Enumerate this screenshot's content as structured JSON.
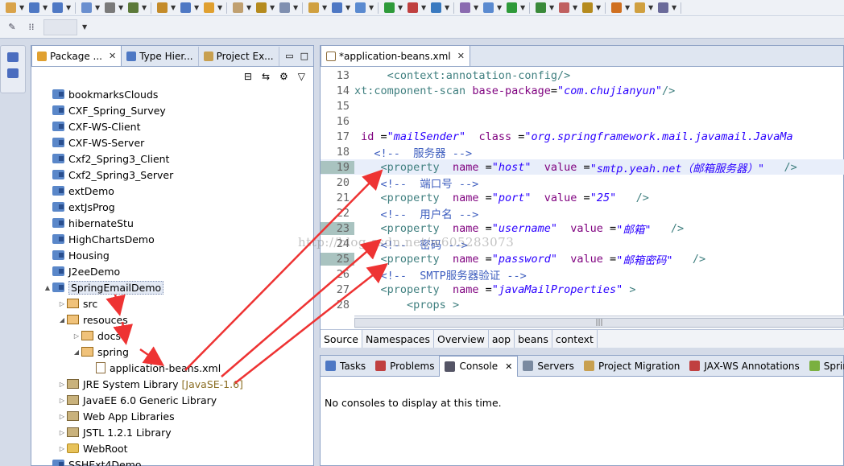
{
  "toolbar": {
    "icons": [
      "new-icon",
      "new-dropdown-icon",
      "save-icon",
      "save-all-icon",
      "print-icon",
      "debug-icon",
      "skip-breakpoints-icon",
      "wrench-icon",
      "back-icon",
      "forward-icon",
      "open-type-icon",
      "open-resource-icon",
      "new-wizard-icon",
      "build-icon",
      "search-icon",
      "run-icon",
      "external-tools-icon",
      "globe-icon",
      "profile-icon",
      "server-icon",
      "run-green-icon",
      "debug-green-icon",
      "coverage-icon",
      "package-icon",
      "refresh-icon",
      "open-folder-icon",
      "pin-icon"
    ]
  },
  "package_explorer": {
    "tabs": [
      {
        "label": "Package ...",
        "icon": "package-explorer-icon",
        "active": true
      },
      {
        "label": "Type Hier...",
        "icon": "type-hierarchy-icon",
        "active": false
      },
      {
        "label": "Project Ex...",
        "icon": "project-explorer-icon",
        "active": false
      }
    ],
    "tree": [
      {
        "label": "bookmarksClouds",
        "kind": "project",
        "depth": 0,
        "twisty": ""
      },
      {
        "label": "CXF_Spring_Survey",
        "kind": "project",
        "depth": 0,
        "twisty": ""
      },
      {
        "label": "CXF-WS-Client",
        "kind": "project",
        "depth": 0,
        "twisty": ""
      },
      {
        "label": "CXF-WS-Server",
        "kind": "project",
        "depth": 0,
        "twisty": ""
      },
      {
        "label": "Cxf2_Spring3_Client",
        "kind": "project",
        "depth": 0,
        "twisty": ""
      },
      {
        "label": "Cxf2_Spring3_Server",
        "kind": "project",
        "depth": 0,
        "twisty": ""
      },
      {
        "label": "extDemo",
        "kind": "project",
        "depth": 0,
        "twisty": ""
      },
      {
        "label": "extJsProg",
        "kind": "project",
        "depth": 0,
        "twisty": ""
      },
      {
        "label": "hibernateStu",
        "kind": "project",
        "depth": 0,
        "twisty": ""
      },
      {
        "label": "HighChartsDemo",
        "kind": "project",
        "depth": 0,
        "twisty": ""
      },
      {
        "label": "Housing",
        "kind": "project",
        "depth": 0,
        "twisty": ""
      },
      {
        "label": "J2eeDemo",
        "kind": "project",
        "depth": 0,
        "twisty": ""
      },
      {
        "label": "SpringEmailDemo",
        "kind": "project",
        "depth": 0,
        "twisty": "▲",
        "selected": true
      },
      {
        "label": "src",
        "kind": "pkg",
        "depth": 1,
        "twisty": "▷"
      },
      {
        "label": "resouces",
        "kind": "pkg",
        "depth": 1,
        "twisty": "◢"
      },
      {
        "label": "docs",
        "kind": "pkg",
        "depth": 2,
        "twisty": "▷"
      },
      {
        "label": "spring",
        "kind": "pkg",
        "depth": 2,
        "twisty": "◢"
      },
      {
        "label": "application-beans.xml",
        "kind": "xml",
        "depth": 3,
        "twisty": ""
      },
      {
        "label": "JRE System Library",
        "kind": "lib",
        "depth": 1,
        "twisty": "▷",
        "tag": "[JavaSE-1.6]"
      },
      {
        "label": "JavaEE 6.0 Generic Library",
        "kind": "lib",
        "depth": 1,
        "twisty": "▷"
      },
      {
        "label": "Web App Libraries",
        "kind": "lib",
        "depth": 1,
        "twisty": "▷"
      },
      {
        "label": "JSTL 1.2.1 Library",
        "kind": "lib",
        "depth": 1,
        "twisty": "▷"
      },
      {
        "label": "WebRoot",
        "kind": "folder",
        "depth": 1,
        "twisty": "▷"
      },
      {
        "label": "SSHExt4Demo",
        "kind": "project",
        "depth": 0,
        "twisty": ""
      }
    ]
  },
  "editor": {
    "tab_label": "*application-beans.xml",
    "lines": [
      {
        "n": "13",
        "parts": [
          [
            "",
            "     "
          ],
          [
            "kw",
            "<context:annotation-config/>"
          ]
        ]
      },
      {
        "n": "14",
        "parts": [
          [
            "kw",
            "xt:component-scan "
          ],
          [
            "attr",
            "base-package"
          ],
          [
            "",
            "="
          ],
          [
            "val",
            "\"com.chujianyun\""
          ],
          [
            "kw",
            "/>"
          ]
        ]
      },
      {
        "n": "15",
        "parts": []
      },
      {
        "n": "16",
        "parts": []
      },
      {
        "n": "17",
        "parts": [
          [
            "attr",
            " id "
          ],
          [
            "",
            "="
          ],
          [
            "val",
            "\"mailSender\""
          ],
          [
            "",
            "  "
          ],
          [
            "attr",
            "class "
          ],
          [
            "",
            "="
          ],
          [
            "val",
            "\"org.springframework.mail.javamail.JavaMa"
          ]
        ]
      },
      {
        "n": "18",
        "parts": [
          [
            "",
            "   "
          ],
          [
            "cmt",
            "<!--  服务器 -->"
          ]
        ]
      },
      {
        "n": "19",
        "hl": true,
        "mark": true,
        "parts": [
          [
            "",
            "    "
          ],
          [
            "kw",
            "<property"
          ],
          [
            "",
            "  "
          ],
          [
            "attr",
            "name "
          ],
          [
            "",
            "="
          ],
          [
            "val",
            "\"host\""
          ],
          [
            "",
            "  "
          ],
          [
            "attr",
            "value "
          ],
          [
            "",
            "="
          ],
          [
            "val",
            "\"smtp.yeah.net（邮箱服务器）\""
          ],
          [
            "",
            "   "
          ],
          [
            "kw",
            "/>"
          ]
        ]
      },
      {
        "n": "20",
        "parts": [
          [
            "",
            "    "
          ],
          [
            "cmt",
            "<!--  端口号 -->"
          ]
        ]
      },
      {
        "n": "21",
        "parts": [
          [
            "",
            "    "
          ],
          [
            "kw",
            "<property"
          ],
          [
            "",
            "  "
          ],
          [
            "attr",
            "name "
          ],
          [
            "",
            "="
          ],
          [
            "val",
            "\"port\""
          ],
          [
            "",
            "  "
          ],
          [
            "attr",
            "value "
          ],
          [
            "",
            "="
          ],
          [
            "val",
            "\"25\""
          ],
          [
            "",
            "   "
          ],
          [
            "kw",
            "/>"
          ]
        ]
      },
      {
        "n": "22",
        "parts": [
          [
            "",
            "    "
          ],
          [
            "cmt",
            "<!--  用户名 -->"
          ]
        ]
      },
      {
        "n": "23",
        "mark": true,
        "parts": [
          [
            "",
            "    "
          ],
          [
            "kw",
            "<property"
          ],
          [
            "",
            "  "
          ],
          [
            "attr",
            "name "
          ],
          [
            "",
            "="
          ],
          [
            "val",
            "\"username\""
          ],
          [
            "",
            "  "
          ],
          [
            "attr",
            "value "
          ],
          [
            "",
            "="
          ],
          [
            "val",
            "\"邮箱\""
          ],
          [
            "",
            "   "
          ],
          [
            "kw",
            "/>"
          ]
        ]
      },
      {
        "n": "24",
        "parts": [
          [
            "",
            "    "
          ],
          [
            "cmt",
            "<!--  密码 -->"
          ]
        ]
      },
      {
        "n": "25",
        "mark": true,
        "parts": [
          [
            "",
            "    "
          ],
          [
            "kw",
            "<property"
          ],
          [
            "",
            "  "
          ],
          [
            "attr",
            "name "
          ],
          [
            "",
            "="
          ],
          [
            "val",
            "\"password\""
          ],
          [
            "",
            "  "
          ],
          [
            "attr",
            "value "
          ],
          [
            "",
            "="
          ],
          [
            "val",
            "\"邮箱密码\""
          ],
          [
            "",
            "   "
          ],
          [
            "kw",
            "/>"
          ]
        ]
      },
      {
        "n": "26",
        "parts": [
          [
            "",
            "    "
          ],
          [
            "cmt",
            "<!--  SMTP服务器验证 -->"
          ]
        ]
      },
      {
        "n": "27",
        "parts": [
          [
            "",
            "    "
          ],
          [
            "kw",
            "<property"
          ],
          [
            "",
            "  "
          ],
          [
            "attr",
            "name "
          ],
          [
            "",
            "="
          ],
          [
            "val",
            "\"javaMailProperties\""
          ],
          [
            "",
            " "
          ],
          [
            "kw",
            ">"
          ]
        ]
      },
      {
        "n": "28",
        "parts": [
          [
            "",
            "        "
          ],
          [
            "kw",
            "<props"
          ],
          [
            "",
            " "
          ],
          [
            "kw",
            ">"
          ]
        ]
      }
    ],
    "bottom_tabs": [
      {
        "label": "Source",
        "active": true
      },
      {
        "label": "Namespaces",
        "active": false
      },
      {
        "label": "Overview",
        "active": false
      },
      {
        "label": "aop",
        "active": false
      },
      {
        "label": "beans",
        "active": false
      },
      {
        "label": "context",
        "active": false
      }
    ]
  },
  "console_panel": {
    "tabs": [
      {
        "label": "Tasks",
        "icon": "tasks-icon",
        "active": false
      },
      {
        "label": "Problems",
        "icon": "problems-icon",
        "active": false
      },
      {
        "label": "Console",
        "icon": "console-icon",
        "active": true
      },
      {
        "label": "Servers",
        "icon": "servers-icon",
        "active": false
      },
      {
        "label": "Project Migration",
        "icon": "migration-icon",
        "active": false
      },
      {
        "label": "JAX-WS Annotations",
        "icon": "jaxws-icon",
        "active": false
      },
      {
        "label": "Spring Anno",
        "icon": "spring-icon",
        "active": false
      }
    ],
    "message": "No consoles to display at this time."
  },
  "watermark": "http://blog.csdn.net/w605283073",
  "colors": {
    "accent": "#5a87c9",
    "arrow": "#ee3333",
    "panel_border": "#8fa3c6"
  }
}
